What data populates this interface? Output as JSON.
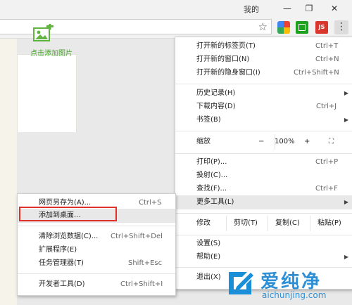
{
  "window": {
    "profile": "我的",
    "minimize": "—",
    "restore": "❐",
    "close": "✕"
  },
  "toolbar": {
    "ext_red_label": "JS",
    "menu_glyph": "⋮"
  },
  "page": {
    "add_image_label": "点击添加图片"
  },
  "main_menu": {
    "new_tab": {
      "label": "打开新的标签页(T)",
      "shortcut": "Ctrl+T"
    },
    "new_window": {
      "label": "打开新的窗口(N)",
      "shortcut": "Ctrl+N"
    },
    "incognito": {
      "label": "打开新的隐身窗口(I)",
      "shortcut": "Ctrl+Shift+N"
    },
    "history": {
      "label": "历史记录(H)"
    },
    "downloads": {
      "label": "下载内容(D)",
      "shortcut": "Ctrl+J"
    },
    "bookmarks": {
      "label": "书签(B)"
    },
    "zoom": {
      "label": "缩放",
      "minus": "−",
      "value": "100%",
      "plus": "+",
      "fullscreen": "⛶"
    },
    "print": {
      "label": "打印(P)...",
      "shortcut": "Ctrl+P"
    },
    "cast": {
      "label": "投射(C)..."
    },
    "find": {
      "label": "查找(F)...",
      "shortcut": "Ctrl+F"
    },
    "more_tools": {
      "label": "更多工具(L)"
    },
    "edit": {
      "label": "修改",
      "cut": "剪切(T)",
      "copy": "复制(C)",
      "paste": "粘贴(P)"
    },
    "settings": {
      "label": "设置(S)"
    },
    "help": {
      "label": "帮助(E)"
    },
    "exit": {
      "label": "退出(X)"
    }
  },
  "sub_menu": {
    "save_as": {
      "label": "网页另存为(A)...",
      "shortcut": "Ctrl+S"
    },
    "add_to_desktop": {
      "label": "添加到桌面..."
    },
    "clear_data": {
      "label": "清除浏览数据(C)...",
      "shortcut": "Ctrl+Shift+Del"
    },
    "extensions": {
      "label": "扩展程序(E)"
    },
    "task_manager": {
      "label": "任务管理器(T)",
      "shortcut": "Shift+Esc"
    },
    "devtools": {
      "label": "开发者工具(D)",
      "shortcut": "Ctrl+Shift+I"
    }
  },
  "watermark": {
    "title": "爱纯净",
    "url": "aichunjing.com"
  }
}
